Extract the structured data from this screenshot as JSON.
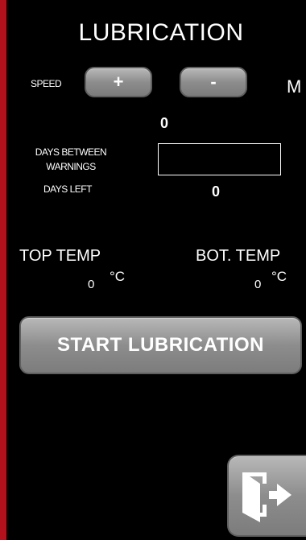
{
  "screen": {
    "title": "LUBRICATION"
  },
  "speed": {
    "label": "SPEED",
    "plus_label": "+",
    "minus_label": "-",
    "mode_letter": "M",
    "value": "0"
  },
  "warnings": {
    "label_line1": "DAYS BETWEEN",
    "label_line2": "WARNINGS",
    "input_value": "",
    "days_left_label": "DAYS LEFT",
    "days_left_value": "0"
  },
  "temperature": {
    "top_label": "TOP TEMP",
    "top_value": "0",
    "top_unit": "°C",
    "bottom_label": "BOT. TEMP",
    "bottom_value": "0",
    "bottom_unit": "°C"
  },
  "actions": {
    "start_label": "START LUBRICATION",
    "exit_icon": "exit-door-icon"
  },
  "colors": {
    "background": "#000000",
    "accent": "#b3121d",
    "button": "#8d8d8d",
    "text": "#ffffff"
  }
}
